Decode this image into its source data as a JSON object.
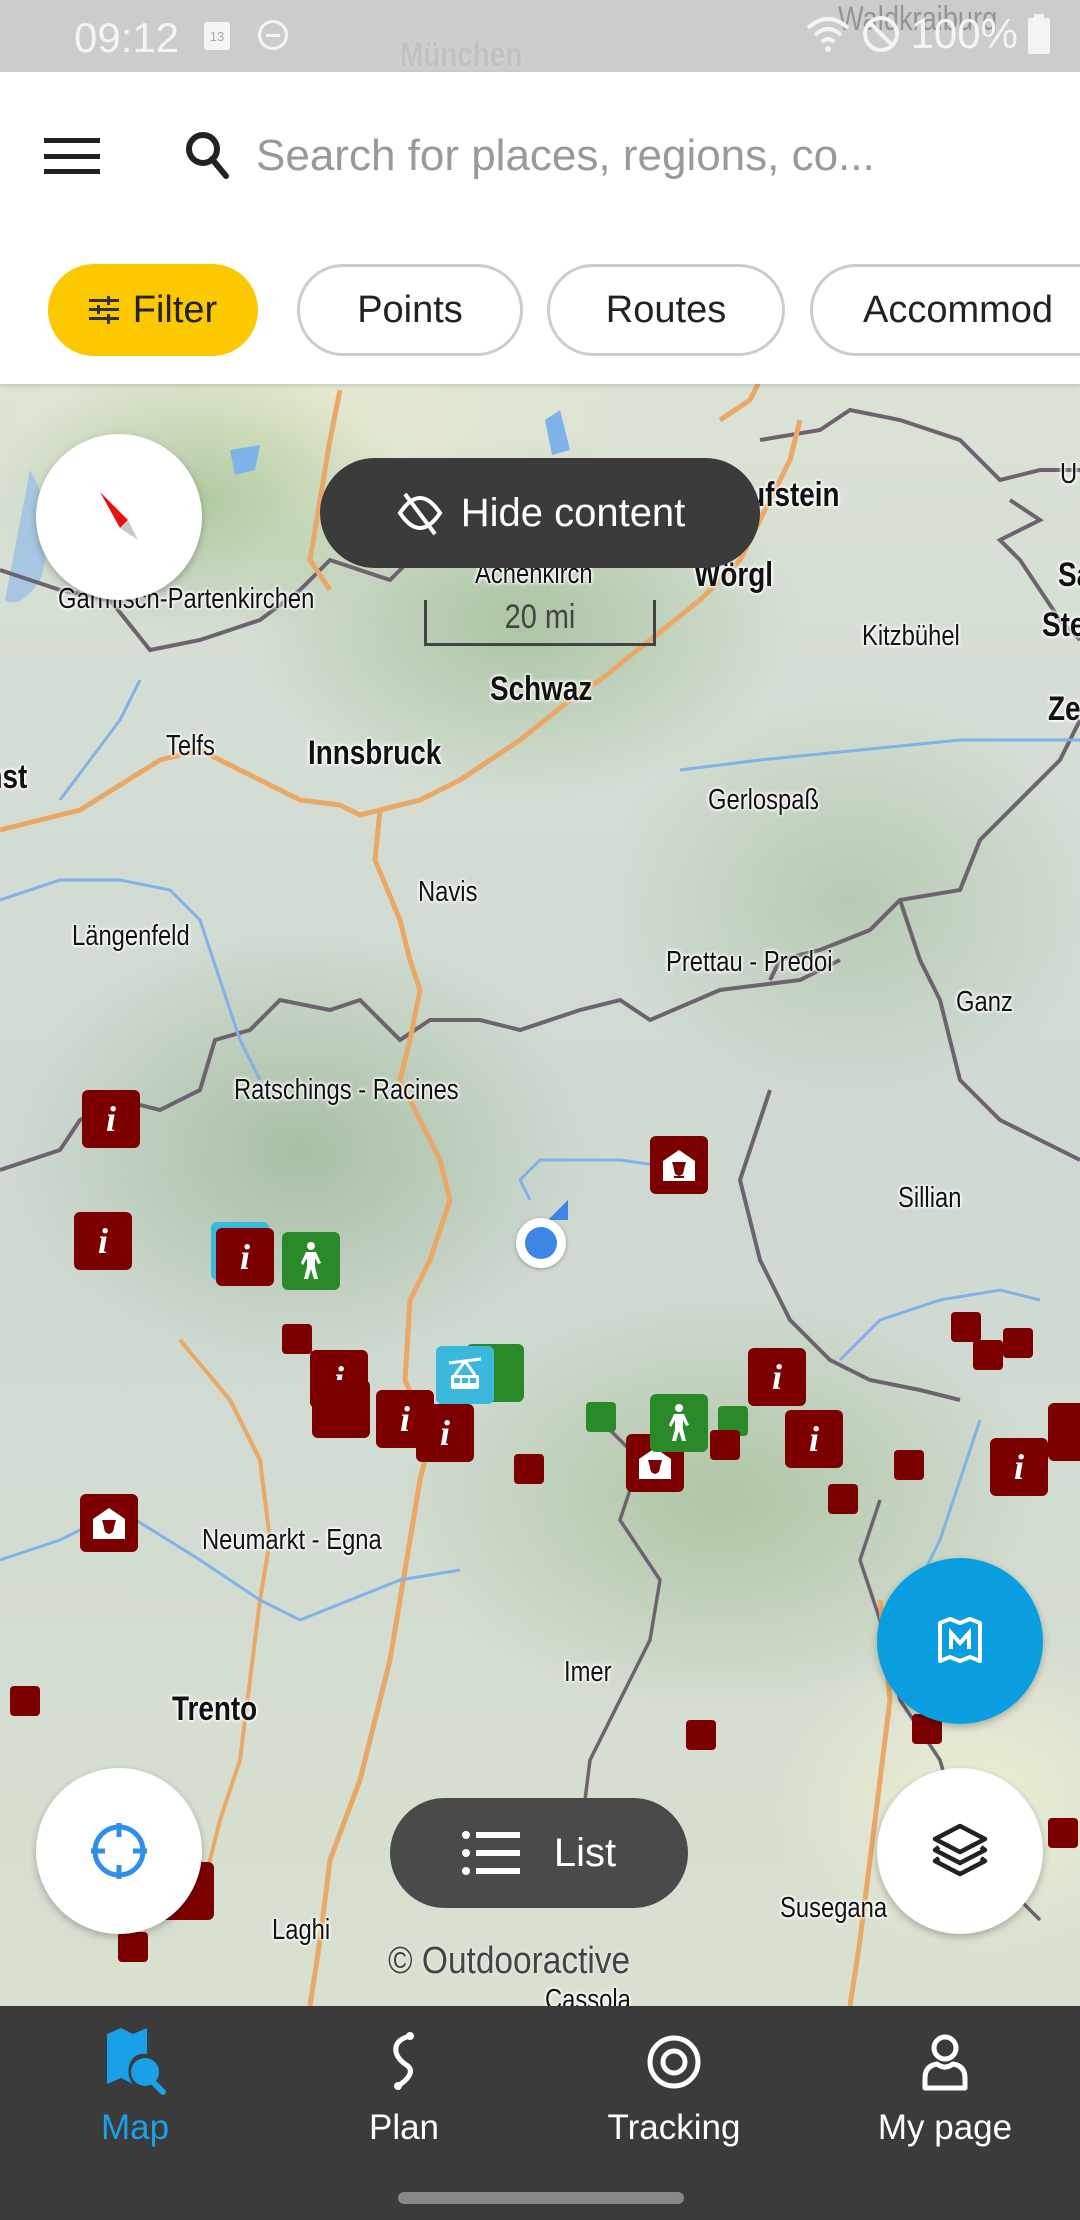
{
  "status_bar": {
    "time": "09:12",
    "calendar_day": "13",
    "battery": "100%",
    "bg_labels": [
      "München",
      "Waldkraiburg"
    ]
  },
  "header": {
    "search_placeholder": "Search for places, regions, co...",
    "chips": [
      {
        "label": "Filter",
        "active": true
      },
      {
        "label": "Points",
        "active": false
      },
      {
        "label": "Routes",
        "active": false
      },
      {
        "label": "Accommod",
        "active": false
      }
    ]
  },
  "map": {
    "hide_content_label": "Hide content",
    "scale_label": "20 mi",
    "list_label": "List",
    "copyright": "© Outdooractive",
    "places": [
      {
        "name": "Garmisch-Partenkirchen",
        "bold": false
      },
      {
        "name": "Achenkirch",
        "bold": false
      },
      {
        "name": "Wörgl",
        "bold": true
      },
      {
        "name": "Kufstein",
        "bold": true
      },
      {
        "name": "Kitzbühel",
        "bold": false
      },
      {
        "name": "Schwaz",
        "bold": true
      },
      {
        "name": "Telfs",
        "bold": false
      },
      {
        "name": "Innsbruck",
        "bold": true
      },
      {
        "name": "Imst",
        "bold": true
      },
      {
        "name": "Gerlospaß",
        "bold": false
      },
      {
        "name": "Navis",
        "bold": false
      },
      {
        "name": "Längenfeld",
        "bold": false
      },
      {
        "name": "Prettau - Predoi",
        "bold": false
      },
      {
        "name": "Ganz",
        "bold": false
      },
      {
        "name": "Ratschings - Racines",
        "bold": false
      },
      {
        "name": "Sillian",
        "bold": false
      },
      {
        "name": "Neumarkt - Egna",
        "bold": false
      },
      {
        "name": "Imer",
        "bold": false
      },
      {
        "name": "Trento",
        "bold": true
      },
      {
        "name": "Laghi",
        "bold": false
      },
      {
        "name": "Susegana",
        "bold": false
      },
      {
        "name": "Cassola",
        "bold": false
      },
      {
        "name": "U",
        "bold": false
      },
      {
        "name": "Sa",
        "bold": true
      },
      {
        "name": "Ste",
        "bold": true
      },
      {
        "name": "Ze",
        "bold": true
      }
    ],
    "marker_info_glyph": "i",
    "colors": {
      "poi_marker": "#7d0000",
      "hiking_marker": "#2a8a2a",
      "cablecar_marker": "#3bb9dc",
      "location": "#3d86e6",
      "compass_needle": "#e81010"
    }
  },
  "bottom_nav": {
    "items": [
      {
        "label": "Map",
        "icon": "map-search-icon",
        "active": true
      },
      {
        "label": "Plan",
        "icon": "route-plan-icon",
        "active": false
      },
      {
        "label": "Tracking",
        "icon": "tracking-target-icon",
        "active": false
      },
      {
        "label": "My page",
        "icon": "user-icon",
        "active": false
      }
    ]
  },
  "colors": {
    "accent": "#1aa0e8",
    "filter_chip": "#fcc800",
    "nav_bg": "#3b3b3b",
    "fab_blue": "#0a9ee0"
  }
}
